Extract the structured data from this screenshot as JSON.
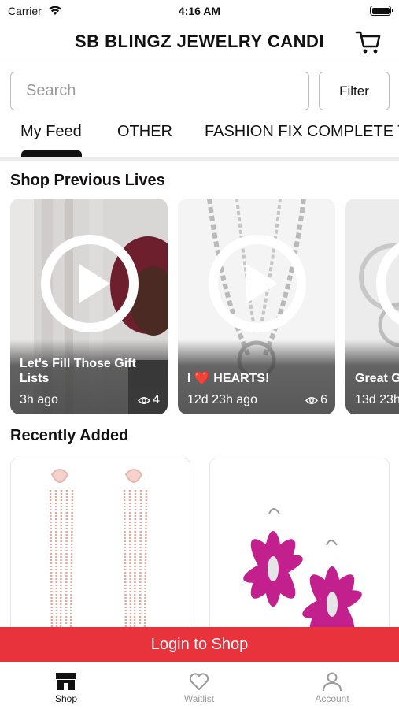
{
  "status_bar": {
    "carrier": "Carrier",
    "time": "4:16 AM"
  },
  "header": {
    "title": "SB BLINGZ JEWELRY CANDI",
    "cart_icon": "cart-icon"
  },
  "search": {
    "placeholder": "Search",
    "value": "",
    "filter_label": "Filter"
  },
  "tabs": [
    {
      "label": "My Feed",
      "active": true
    },
    {
      "label": "OTHER",
      "active": false
    },
    {
      "label": "FASHION FIX COMPLETE T",
      "active": false
    }
  ],
  "sections": {
    "previous_lives_title": "Shop Previous Lives",
    "recently_added_title": "Recently Added"
  },
  "lives": [
    {
      "title": "Let's Fill Those Gift Lists",
      "time": "3h ago",
      "views": "4"
    },
    {
      "title": "I ❤️ HEARTS!",
      "time": "12d 23h ago",
      "views": "6"
    },
    {
      "title": "Great G Stuffers",
      "time": "13d 23h",
      "views": ""
    }
  ],
  "login_bar": {
    "label": "Login to Shop"
  },
  "bottom_nav": [
    {
      "label": "Shop",
      "icon": "store-icon",
      "active": true
    },
    {
      "label": "Waitlist",
      "icon": "heart-icon",
      "active": false
    },
    {
      "label": "Account",
      "icon": "person-icon",
      "active": false
    }
  ],
  "colors": {
    "accent_red": "#e8333c",
    "text": "#111111",
    "muted": "#9a9a9a"
  }
}
